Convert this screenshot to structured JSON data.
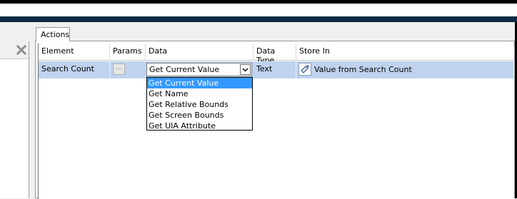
{
  "tab": {
    "label": "Actions"
  },
  "columns": {
    "element": "Element",
    "params": "Params",
    "data": "Data",
    "data_type": "Data Type",
    "store_in": "Store In"
  },
  "row": {
    "element": "Search Count",
    "params_button": "...",
    "data_value": "Get Current Value",
    "data_type": "Text",
    "store_in": "Value from Search Count"
  },
  "dropdown": {
    "options": [
      "Get Current Value",
      "Get Name",
      "Get Relative Bounds",
      "Get Screen Bounds",
      "Get UIA Attribute"
    ]
  },
  "icons": {
    "clear": "close-x-icon",
    "combo": "chevron-down-icon",
    "store": "tag-icon"
  },
  "colors": {
    "selected_row": "#bfd3ee",
    "highlight": "#3399ff",
    "title_band": "#0f2a45"
  }
}
